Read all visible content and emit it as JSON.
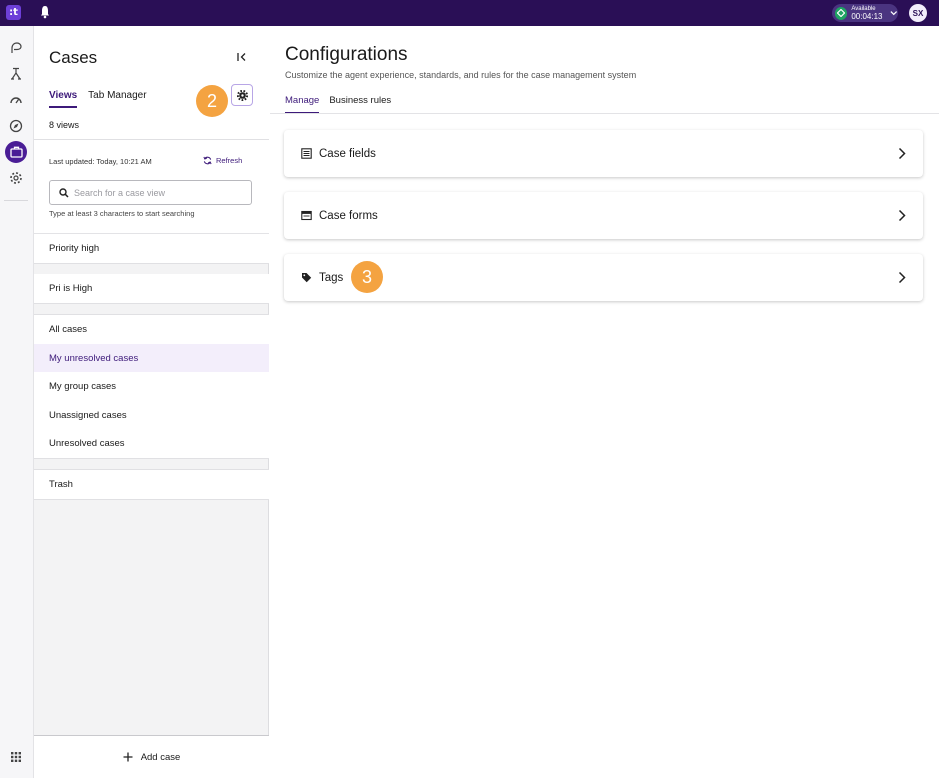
{
  "topbar": {
    "logo_text": ":t",
    "status_label": "Available",
    "status_time": "00:04:13",
    "avatar_initials": "SX"
  },
  "rail": {
    "icons": [
      "routing-icon",
      "flow-icon",
      "dashboard-icon",
      "compass-icon",
      "cases-icon",
      "settings-icon",
      "apps-grid-icon"
    ],
    "active": "cases-icon"
  },
  "sidebar": {
    "title": "Cases",
    "tabs": [
      {
        "label": "Views",
        "active": true
      },
      {
        "label": "Tab Manager",
        "active": false
      }
    ],
    "views_count": "8 views",
    "last_updated": "Last updated: Today, 10:21 AM",
    "refresh_label": "Refresh",
    "search": {
      "placeholder": "Search for a case view",
      "value": "",
      "hint": "Type at least 3 characters to start searching"
    },
    "view_groups": [
      [
        "Priority high"
      ],
      [
        "Pri is High"
      ],
      [
        "All cases",
        "My unresolved cases",
        "My group cases",
        "Unassigned cases",
        "Unresolved cases"
      ],
      [
        "Trash"
      ]
    ],
    "selected_view": "My unresolved cases",
    "add_case_label": "Add case"
  },
  "main": {
    "title": "Configurations",
    "subtitle": "Customize the agent experience, standards, and rules for the case management system",
    "tabs": [
      {
        "label": "Manage",
        "active": true
      },
      {
        "label": "Business rules",
        "active": false
      }
    ],
    "cards": [
      {
        "label": "Case fields",
        "icon": "list-icon"
      },
      {
        "label": "Case forms",
        "icon": "form-icon"
      },
      {
        "label": "Tags",
        "icon": "tag-icon"
      }
    ]
  },
  "annotations": {
    "badge_2": "2",
    "badge_3": "3"
  },
  "colors": {
    "topbar": "#2a0f56",
    "accent": "#3d1a7a",
    "badge": "#f4a341",
    "status_green": "#1fa463"
  }
}
